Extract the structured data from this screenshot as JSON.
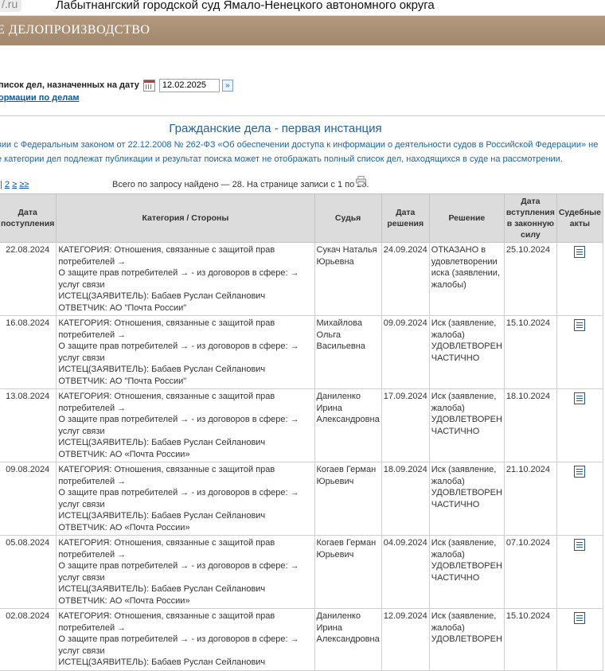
{
  "browser": {
    "domain_fragment": "/.ru",
    "page_title": "Лабытнангский городской суд Ямало-Ненецкого автономного округа"
  },
  "banner": {
    "text": "Е ДЕЛОПРОИЗВОДСТВО"
  },
  "search": {
    "label": "писок дел, назначенных на дату",
    "date_value": "12.02.2025",
    "info_link": "ормации по делам"
  },
  "section": {
    "heading": "Гражданские дела - первая инстанция",
    "notice_line1": "вии с Федеральным законом от 22.12.2008 № 262-ФЗ «Об обеспечении доступа к информации о деятельности судов в Российской Федерации» не",
    "notice_line2": "е категории дел подлежат публикации и результат поиска может не отображать полный список дел, находящихся в суде на рассмотрении."
  },
  "pagination": {
    "prefix": "| ",
    "page2": "2",
    "next": "≥",
    "last": "≥≥",
    "found_text": "Всего по запросу найдено — 28. На странице записи с 1 по 25."
  },
  "table": {
    "headers": {
      "received": "Дата поступления",
      "category": "Категория / Стороны",
      "judge": "Судья",
      "decision_date": "Дата решения",
      "decision": "Решение",
      "effective_date": "Дата вступления в законную силу",
      "acts": "Судебные акты"
    },
    "rows": [
      {
        "received": "22.08.2024",
        "cat1": "КАТЕГОРИЯ: Отношения, связанные с защитой прав потребителей →",
        "cat2": "О защите прав потребителей → - из договоров в сфере: → услуг связи",
        "cat3": "ИСТЕЦ(ЗАЯВИТЕЛЬ): Бабаев Руслан Сейланович",
        "cat4": "ОТВЕТЧИК: АО \"Почта России\"",
        "judge1": "Сукач Наталья",
        "judge2": "Юрьевна",
        "judge3": "",
        "decision_date": "24.09.2024",
        "dec1": "ОТКАЗАНО в",
        "dec2": "удовлетворении",
        "dec3": "иска (заявлении,",
        "dec4": "жалобы)",
        "effective": "25.10.2024"
      },
      {
        "received": "16.08.2024",
        "cat1": "КАТЕГОРИЯ: Отношения, связанные с защитой прав потребителей →",
        "cat2": "О защите прав потребителей → - из договоров в сфере: → услуг связи",
        "cat3": "ИСТЕЦ(ЗАЯВИТЕЛЬ): Бабаев Руслан Сейланович",
        "cat4": "ОТВЕТЧИК: АО \"Почта России\"",
        "judge1": "Михайлова",
        "judge2": "Ольга",
        "judge3": "Васильевна",
        "decision_date": "09.09.2024",
        "dec1": "Иск (заявление,",
        "dec2": "жалоба)",
        "dec3": "УДОВЛЕТВОРЕН",
        "dec4": "ЧАСТИЧНО",
        "effective": "15.10.2024"
      },
      {
        "received": "13.08.2024",
        "cat1": "КАТЕГОРИЯ: Отношения, связанные с защитой прав потребителей →",
        "cat2": "О защите прав потребителей → - из договоров в сфере: → услуг связи",
        "cat3": "ИСТЕЦ(ЗАЯВИТЕЛЬ): Бабаев Руслан Сейланович",
        "cat4": "ОТВЕТЧИК: АО «Почта России»",
        "judge1": "Даниленко",
        "judge2": "Ирина",
        "judge3": "Александровна",
        "decision_date": "17.09.2024",
        "dec1": "Иск (заявление,",
        "dec2": "жалоба)",
        "dec3": "УДОВЛЕТВОРЕН",
        "dec4": "ЧАСТИЧНО",
        "effective": "18.10.2024"
      },
      {
        "received": "09.08.2024",
        "cat1": "КАТЕГОРИЯ: Отношения, связанные с защитой прав потребителей →",
        "cat2": "О защите прав потребителей → - из договоров в сфере: → услуг связи",
        "cat3": "ИСТЕЦ(ЗАЯВИТЕЛЬ): Бабаев Руслан Сейланович",
        "cat4": "ОТВЕТЧИК: АО «Почта России»",
        "judge1": "Когаев Герман",
        "judge2": "Юрьевич",
        "judge3": "",
        "decision_date": "18.09.2024",
        "dec1": "Иск (заявление,",
        "dec2": "жалоба)",
        "dec3": "УДОВЛЕТВОРЕН",
        "dec4": "ЧАСТИЧНО",
        "effective": "21.10.2024"
      },
      {
        "received": "05.08.2024",
        "cat1": "КАТЕГОРИЯ: Отношения, связанные с защитой прав потребителей →",
        "cat2": "О защите прав потребителей → - из договоров в сфере: → услуг связи",
        "cat3": "ИСТЕЦ(ЗАЯВИТЕЛЬ): Бабаев Руслан Сейланович",
        "cat4": "ОТВЕТЧИК: АО «Почта России»",
        "judge1": "Когаев Герман",
        "judge2": "Юрьевич",
        "judge3": "",
        "decision_date": "04.09.2024",
        "dec1": "Иск (заявление,",
        "dec2": "жалоба)",
        "dec3": "УДОВЛЕТВОРЕН",
        "dec4": "ЧАСТИЧНО",
        "effective": "07.10.2024"
      },
      {
        "received": "02.08.2024",
        "cat1": "КАТЕГОРИЯ: Отношения, связанные с защитой прав потребителей →",
        "cat2": "О защите прав потребителей → - из договоров в сфере: → услуг связи",
        "cat3": "ИСТЕЦ(ЗАЯВИТЕЛЬ): Бабаев Руслан Сейланович",
        "cat4": "",
        "judge1": "Даниленко",
        "judge2": "Ирина",
        "judge3": "Александровна",
        "decision_date": "12.09.2024",
        "dec1": "Иск (заявление,",
        "dec2": "жалоба)",
        "dec3": "УДОВЛЕТВОРЕН",
        "dec4": "",
        "effective": "15.10.2024"
      }
    ]
  },
  "icons": {
    "calendar": "calendar-icon",
    "go": "go-arrow-icon",
    "print": "printer-icon",
    "document": "document-icon"
  }
}
